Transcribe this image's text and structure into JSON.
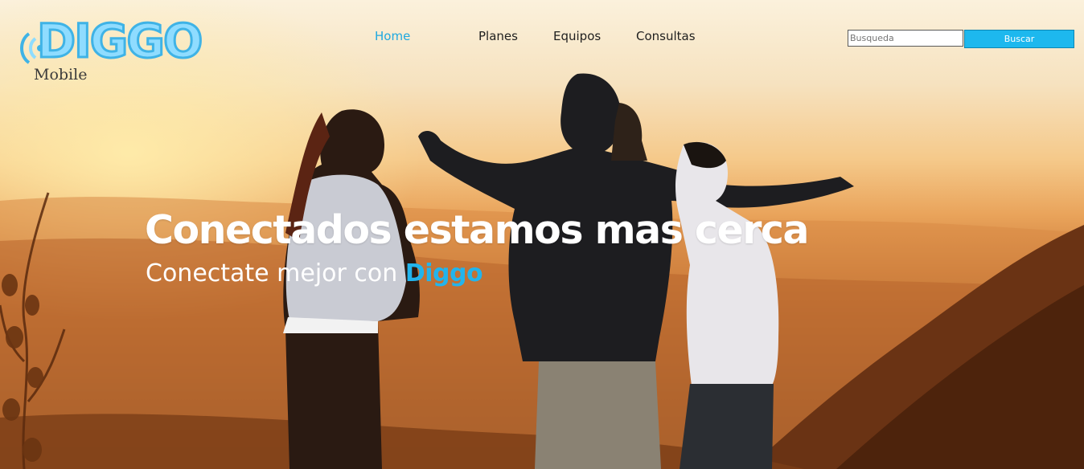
{
  "brand": {
    "logo_text": "DIGGO",
    "logo_sub": "Mobile"
  },
  "nav": {
    "items": [
      {
        "label": "Home",
        "active": true
      },
      {
        "label": "Planes",
        "active": false
      },
      {
        "label": "Equipos",
        "active": false
      },
      {
        "label": "Consultas",
        "active": false
      }
    ]
  },
  "search": {
    "placeholder": "Busqueda",
    "button_label": "Buscar"
  },
  "hero": {
    "headline": "Conectados estamos mas cerca",
    "subline_prefix": "Conectate mejor con",
    "subline_brand": "Diggo",
    "image_alt": "friends-celebrating-sunset-photo"
  },
  "colors": {
    "accent": "#1fa8e0",
    "button": "#1db8ee",
    "logo_fill": "#8fdcff",
    "logo_stroke": "#3fb3e6"
  }
}
